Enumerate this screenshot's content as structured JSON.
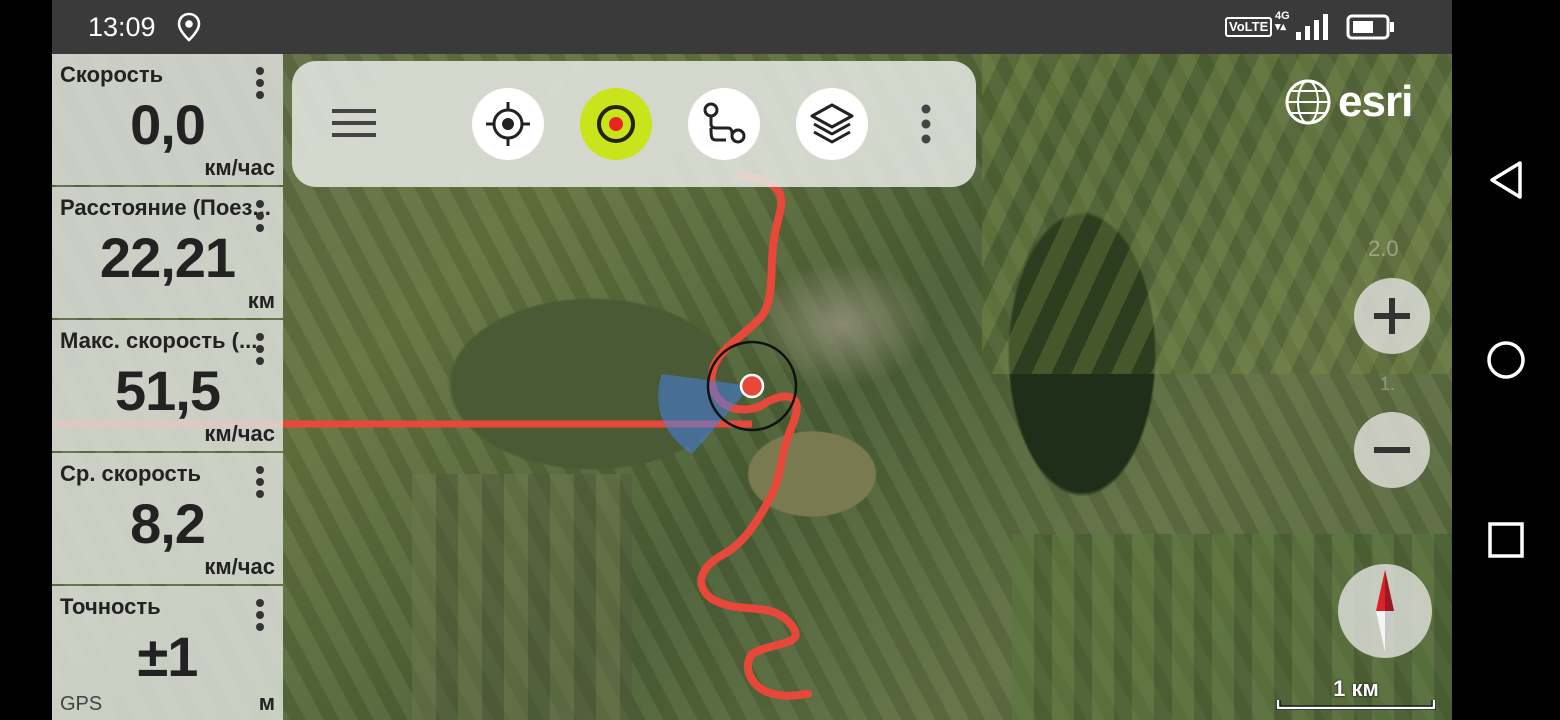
{
  "status_bar": {
    "time": "13:09",
    "location_icon": "location-pin-icon",
    "volte": "VoLTE",
    "network": "4G",
    "signal_icon": "signal-bars-icon",
    "battery_icon": "battery-icon"
  },
  "map": {
    "provider_logo": "esri",
    "scale_label": "1 км",
    "track_color": "#e8483a",
    "zoom_hint_top": "2.0",
    "zoom_hint_mid": "1."
  },
  "toolbar": {
    "menu_icon": "hamburger-menu-icon",
    "buttons": [
      {
        "name": "my-location",
        "icon": "crosshair-target-icon"
      },
      {
        "name": "record-track",
        "icon": "record-dot-icon",
        "active_color": "#c9e41a"
      },
      {
        "name": "tracks",
        "icon": "route-path-icon"
      },
      {
        "name": "layers",
        "icon": "layers-icon"
      }
    ],
    "more_icon": "vertical-dots-icon"
  },
  "widgets": [
    {
      "title": "Скорость",
      "value": "0,0",
      "unit": "км/час",
      "sub": ""
    },
    {
      "title": "Расстояние (Поез...",
      "value": "22,21",
      "unit": "км",
      "sub": ""
    },
    {
      "title": "Макс. скорость (...",
      "value": "51,5",
      "unit": "км/час",
      "sub": ""
    },
    {
      "title": "Ср. скорость",
      "value": "8,2",
      "unit": "км/час",
      "sub": ""
    },
    {
      "title": "Точность",
      "value": "±1",
      "unit": "м",
      "sub": "GPS"
    }
  ],
  "controls": {
    "zoom_in_icon": "plus-icon",
    "zoom_out_icon": "minus-icon",
    "compass_icon": "compass-needle-icon"
  },
  "nav_bar": {
    "back_icon": "back-triangle-icon",
    "home_icon": "home-circle-icon",
    "recents_icon": "recents-square-icon"
  }
}
